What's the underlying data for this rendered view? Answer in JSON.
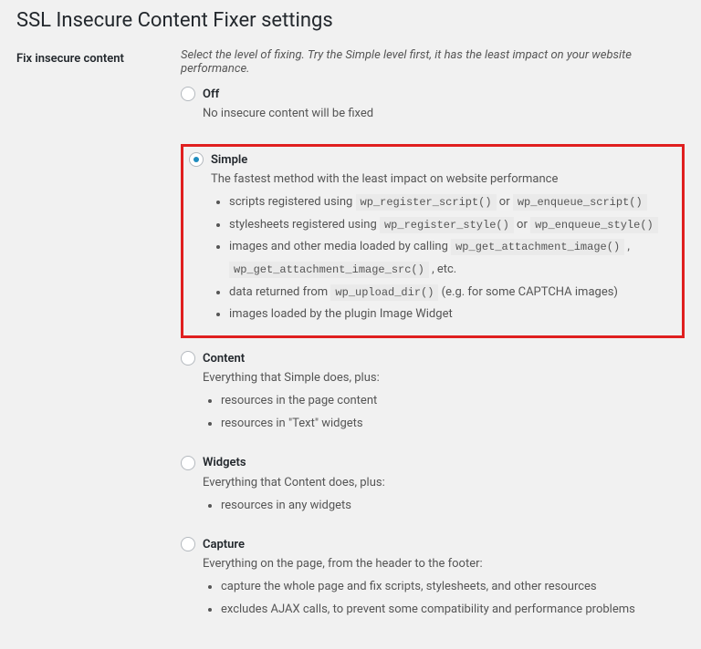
{
  "page_title": "SSL Insecure Content Fixer settings",
  "section_label": "Fix insecure content",
  "intro": "Select the level of fixing. Try the Simple level first, it has the least impact on your website performance.",
  "options": {
    "off": {
      "label": "Off",
      "desc": "No insecure content will be fixed"
    },
    "simple": {
      "label": "Simple",
      "desc": "The fastest method with the least impact on website performance",
      "bullets": {
        "b1_pre": "scripts registered using ",
        "b1_c1": "wp_register_script()",
        "b1_mid": " or ",
        "b1_c2": "wp_enqueue_script()",
        "b2_pre": "stylesheets registered using ",
        "b2_c1": "wp_register_style()",
        "b2_mid": " or ",
        "b2_c2": "wp_enqueue_style()",
        "b3_pre": "images and other media loaded by calling ",
        "b3_c1": "wp_get_attachment_image()",
        "b3_mid": " , ",
        "b3_c2": "wp_get_attachment_image_src()",
        "b3_post": " , etc.",
        "b4_pre": "data returned from ",
        "b4_c1": "wp_upload_dir()",
        "b4_post": " (e.g. for some CAPTCHA images)",
        "b5": "images loaded by the plugin Image Widget"
      }
    },
    "content": {
      "label": "Content",
      "desc": "Everything that Simple does, plus:",
      "bullets": {
        "b1": "resources in the page content",
        "b2": "resources in \"Text\" widgets"
      }
    },
    "widgets": {
      "label": "Widgets",
      "desc": "Everything that Content does, plus:",
      "bullets": {
        "b1": "resources in any widgets"
      }
    },
    "capture": {
      "label": "Capture",
      "desc": "Everything on the page, from the header to the footer:",
      "bullets": {
        "b1": "capture the whole page and fix scripts, stylesheets, and other resources",
        "b2": "excludes AJAX calls, to prevent some compatibility and performance problems"
      }
    }
  }
}
